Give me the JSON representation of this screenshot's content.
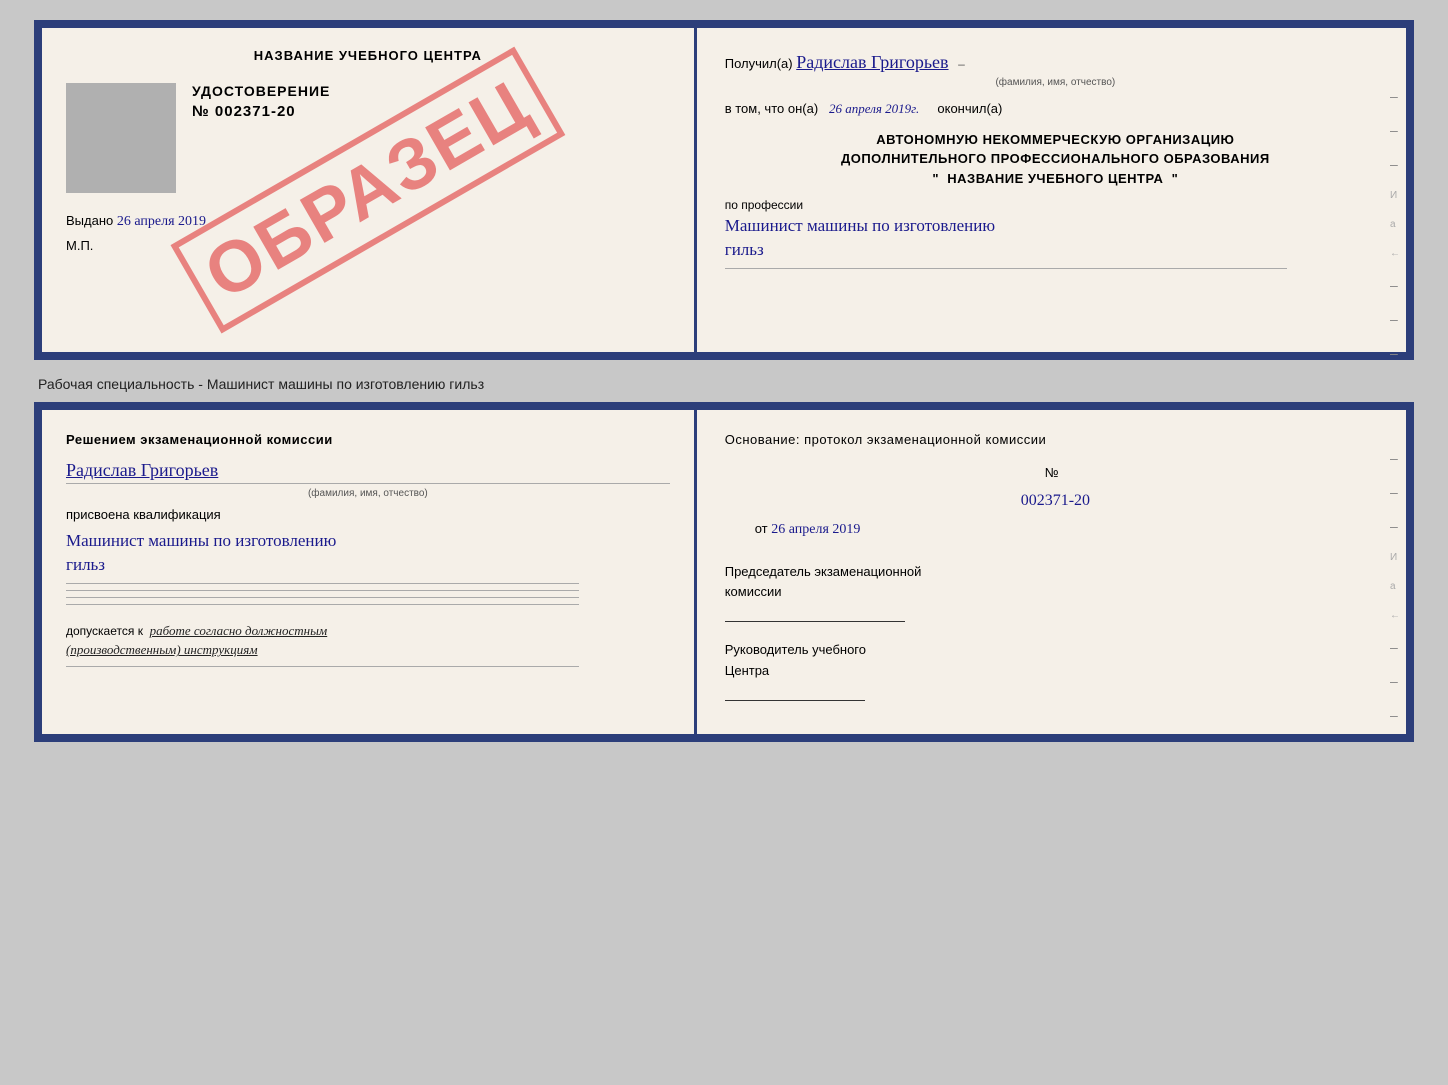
{
  "doc_top": {
    "left": {
      "center_title": "НАЗВАНИЕ УЧЕБНОГО ЦЕНТРА",
      "cert_label": "УДОСТОВЕРЕНИЕ",
      "cert_number": "№ 002371-20",
      "issued_prefix": "Выдано",
      "issued_date": "26 апреля 2019",
      "mp_label": "М.П.",
      "obrazec": "ОБРАЗЕЦ"
    },
    "right": {
      "received_prefix": "Получил(а)",
      "name_handwritten": "Радислав Григорьев",
      "fio_label": "(фамилия, имя, отчество)",
      "date_prefix": "в том, что он(а)",
      "date_handwritten": "26 апреля 2019г.",
      "finished_label": "окончил(а)",
      "org_line1": "АВТОНОМНУЮ НЕКОММЕРЧЕСКУЮ ОРГАНИЗАЦИЮ",
      "org_line2": "ДОПОЛНИТЕЛЬНОГО ПРОФЕССИОНАЛЬНОГО ОБРАЗОВАНИЯ",
      "org_quote_open": "\"",
      "org_name": "НАЗВАНИЕ УЧЕБНОГО ЦЕНТРА",
      "org_quote_close": "\"",
      "profession_prefix": "по профессии",
      "profession_handwritten_line1": "Машинист машины по изготовлению",
      "profession_handwritten_line2": "гильз"
    }
  },
  "middle_text": "Рабочая специальность - Машинист машины по изготовлению гильз",
  "doc_bottom": {
    "left": {
      "section_title_line1": "Решением  экзаменационной  комиссии",
      "name_handwritten": "Радислав Григорьев",
      "fio_label": "(фамилия, имя, отчество)",
      "assigned_label": "присвоена квалификация",
      "qualification_line1": "Машинист машины по изготовлению",
      "qualification_line2": "гильз",
      "dopuskaetsya_prefix": "допускается к",
      "dopuskaetsya_text": "работе согласно должностным\n(производственным) инструкциям"
    },
    "right": {
      "osnovaniye_label": "Основание: протокол экзаменационной  комиссии",
      "number_prefix": "№",
      "number_handwritten": "002371-20",
      "date_prefix": "от",
      "date_handwritten": "26 апреля 2019",
      "chairman_label_line1": "Председатель экзаменационной",
      "chairman_label_line2": "комиссии",
      "center_head_label_line1": "Руководитель учебного",
      "center_head_label_line2": "Центра"
    }
  }
}
